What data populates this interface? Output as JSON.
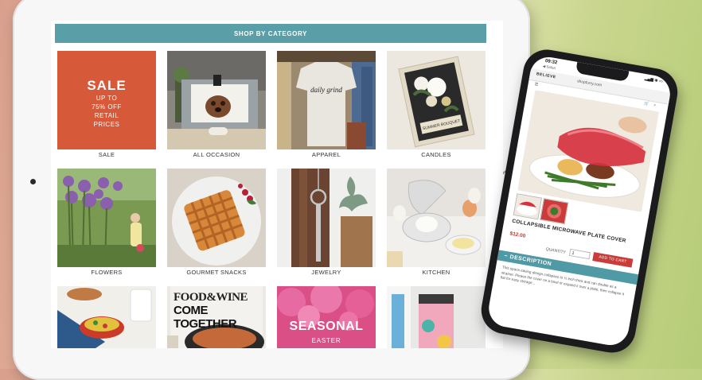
{
  "tablet": {
    "header": "SHOP BY CATEGORY",
    "categories": [
      {
        "label": "SALE"
      },
      {
        "label": "ALL OCCASION"
      },
      {
        "label": "APPAREL"
      },
      {
        "label": "CANDLES"
      },
      {
        "label": "FLOWERS"
      },
      {
        "label": "GOURMET SNACKS"
      },
      {
        "label": "JEWELRY"
      },
      {
        "label": "KITCHEN"
      }
    ],
    "sale_tile": {
      "title": "SALE",
      "line1": "UP TO",
      "line2": "75% OFF",
      "line3": "RETAIL",
      "line4": "PRICES"
    },
    "apparel_tile": {
      "shirt_text": "daily grind"
    },
    "candles_tile": {
      "label_text": "SUMMER BOUQUET"
    },
    "magazine_tile": {
      "title": "FOOD&WINE",
      "subtitle": "COME TOGETHER"
    },
    "seasonal_tile": {
      "title": "SEASONAL",
      "subtitle": "EASTER"
    }
  },
  "phone": {
    "time": "09:32",
    "back_label": "◀ Safari",
    "site_logo": "BELIEVE",
    "url": "shopfurry.com",
    "product_title": "COLLAPSIBLE MICROWAVE PLATE COVER",
    "price": "$12.00",
    "quantity_label": "QUANTITY",
    "quantity_value": "1",
    "add_to_cart": "ADD TO CART",
    "description_header": "DESCRIPTION",
    "description_text": "This space-saving design collapses to ½ inch thick and can double as a strainer. Please the cover on a bowl or expand it over a plate, then collapse it flat for easy storage..."
  },
  "colors": {
    "header_teal": "#5a9ea7",
    "sale_orange": "#d65a3a",
    "cart_red": "#c93c3a",
    "price_red": "#c0392b"
  }
}
